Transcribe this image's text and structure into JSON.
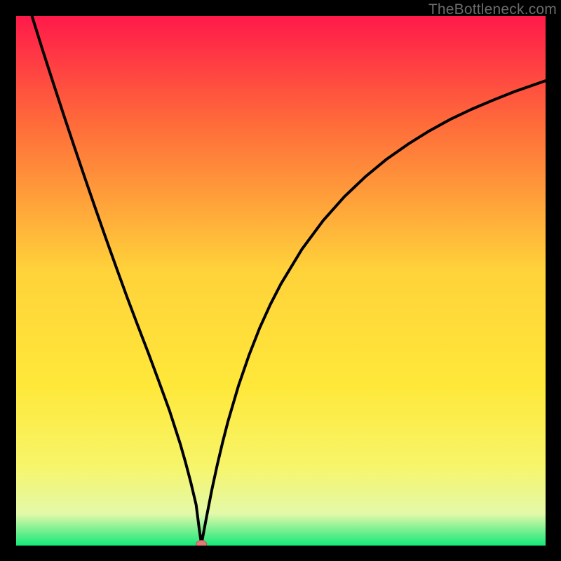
{
  "watermark": "TheBottleneck.com",
  "colors": {
    "frame_bg": "#000000",
    "gradient_top": "#ff1a4a",
    "gradient_mid1": "#ff7a3a",
    "gradient_mid2": "#ffd23a",
    "gradient_mid3": "#f7f56a",
    "gradient_mid4": "#e3f9a9",
    "gradient_bottom": "#15e87a",
    "curve": "#000000",
    "marker_fill": "#e07a7a",
    "marker_stroke": "#c94f4f"
  },
  "chart_data": {
    "type": "line",
    "title": "",
    "xlabel": "",
    "ylabel": "",
    "xlim": [
      0,
      100
    ],
    "ylim": [
      0,
      100
    ],
    "x": [
      3.0,
      5,
      7,
      9,
      11,
      13,
      15,
      17,
      19,
      21,
      23,
      25,
      27,
      29,
      31,
      32,
      33,
      34,
      34.6,
      35,
      36,
      37,
      38,
      39,
      40,
      42,
      44,
      46,
      48,
      50,
      54,
      58,
      62,
      66,
      70,
      74,
      78,
      82,
      86,
      90,
      94,
      100
    ],
    "values": [
      100,
      93.6,
      87.4,
      81.3,
      75.3,
      69.4,
      63.6,
      57.9,
      52.3,
      46.8,
      41.5,
      36.3,
      30.9,
      25.4,
      19.2,
      15.7,
      11.9,
      7.7,
      3.0,
      0.3,
      5.6,
      10.7,
      15.3,
      19.5,
      23.4,
      30.2,
      36.0,
      41.1,
      45.5,
      49.4,
      56.0,
      61.4,
      65.9,
      69.7,
      73.0,
      75.8,
      78.3,
      80.5,
      82.4,
      84.1,
      85.7,
      87.8
    ],
    "marker": {
      "x": 35.0,
      "y": 0.25
    },
    "notes": "x and y are in percent of plot area; y=0 at bottom (green), y=100 at top (red). Curve represents bottleneck % vs. component balance; minimum (~0%) occurs near x≈35."
  }
}
